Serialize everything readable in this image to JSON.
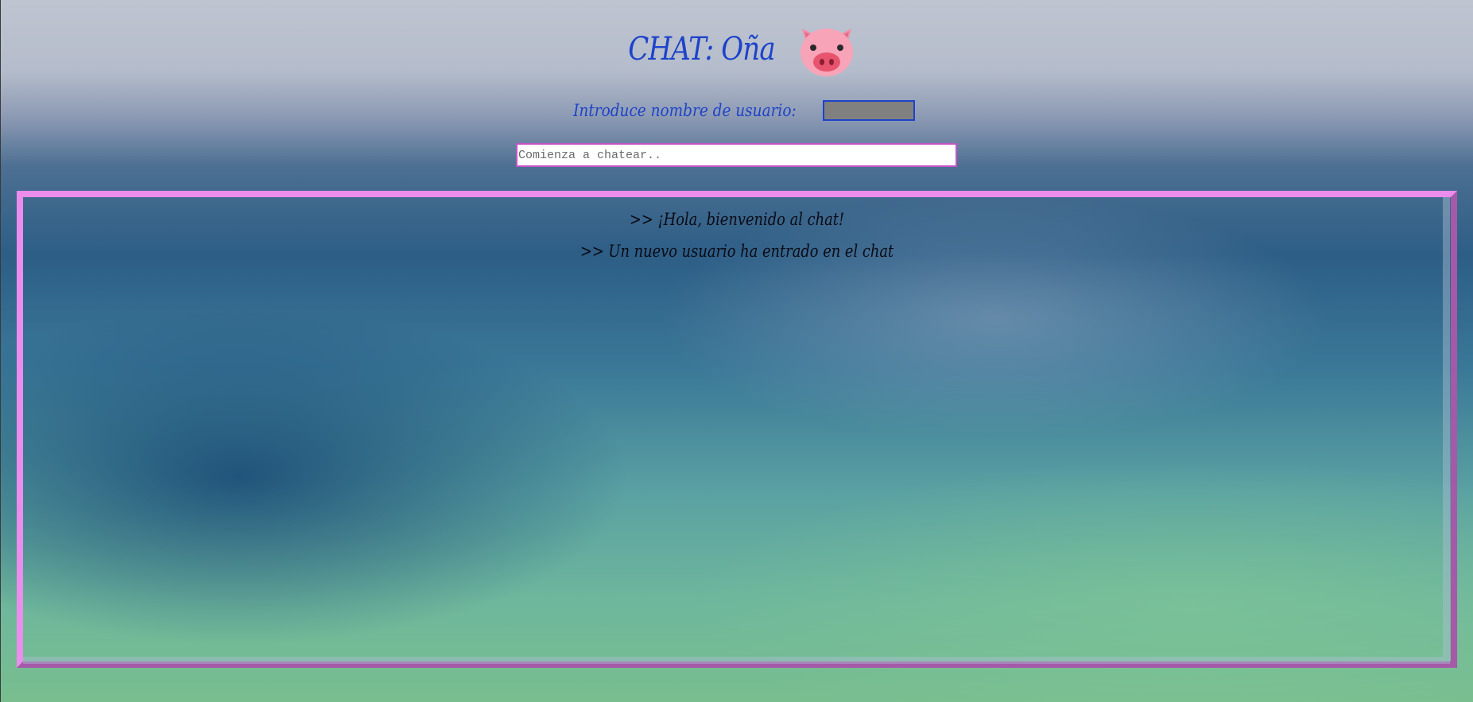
{
  "header": {
    "title": "CHAT: Oña",
    "logo_icon": "pig-face-icon"
  },
  "user": {
    "label": "Introduce nombre de usuario:",
    "value": ""
  },
  "chat": {
    "input_placeholder": "Comienza a chatear..",
    "input_value": "",
    "messages": [
      {
        "text": ">> ¡Hola, bienvenido al chat!"
      },
      {
        "text": ">> Un nuevo usuario ha entrado en el chat"
      }
    ]
  },
  "colors": {
    "title": "#1d43c9",
    "chat_border_light": "#ec8cec",
    "chat_border_dark": "#a45aa8",
    "input_border": "#c653c6",
    "username_box": "#808080"
  }
}
